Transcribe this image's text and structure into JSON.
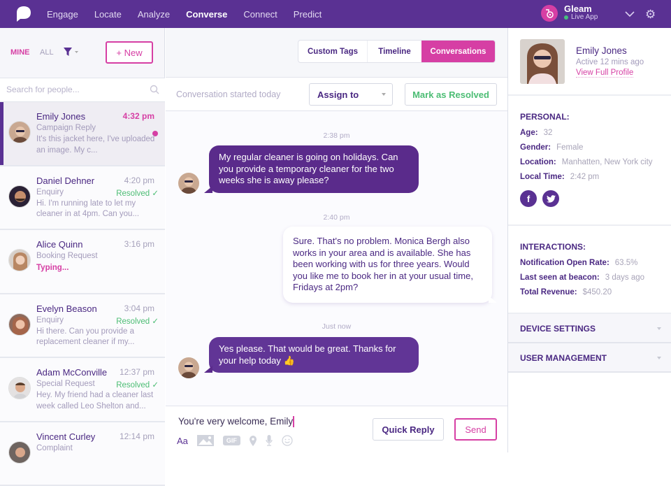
{
  "topbar": {
    "nav": [
      {
        "label": "Engage",
        "active": false
      },
      {
        "label": "Locate",
        "active": false
      },
      {
        "label": "Analyze",
        "active": false
      },
      {
        "label": "Converse",
        "active": true
      },
      {
        "label": "Connect",
        "active": false
      },
      {
        "label": "Predict",
        "active": false
      }
    ],
    "app": {
      "name": "Gleam",
      "status": "Live App",
      "icon": "vacuum-cleaner-icon"
    }
  },
  "left": {
    "filter_mine": "MINE",
    "filter_all": "ALL",
    "new_button": "+ New",
    "search_placeholder": "Search for people...",
    "conversations": [
      {
        "name": "Emily Jones",
        "time": "4:32 pm",
        "subject": "Campaign Reply",
        "status": "",
        "preview": "It's this jacket here, I've uploaded an image. My c...",
        "unread": true,
        "active": true
      },
      {
        "name": "Daniel Dehner",
        "time": "4:20 pm",
        "subject": "Enquiry",
        "status": "Resolved ✓",
        "preview": "Hi. I'm running late to let my cleaner in at 4pm. Can you..."
      },
      {
        "name": "Alice Quinn",
        "time": "3:16 pm",
        "subject": "Booking Request",
        "status": "",
        "typing": "Typing..."
      },
      {
        "name": "Evelyn Beason",
        "time": "3:04 pm",
        "subject": "Enquiry",
        "status": "Resolved ✓",
        "preview": "Hi there. Can you provide a replacement cleaner if my..."
      },
      {
        "name": "Adam McConville",
        "time": "12:37 pm",
        "subject": "Special Request",
        "status": "Resolved ✓",
        "preview": "Hey. My friend had a cleaner last week called Leo Shelton and..."
      },
      {
        "name": "Vincent Curley",
        "time": "12:14 pm",
        "subject": "Complaint",
        "status": "",
        "preview": ""
      }
    ]
  },
  "center": {
    "tabs": [
      "Custom Tags",
      "Timeline",
      "Conversations"
    ],
    "active_tab": "Conversations",
    "conversation_started": "Conversation started today",
    "assign_to": "Assign to",
    "mark_resolved": "Mark as Resolved",
    "messages": [
      {
        "time": "2:38 pm",
        "direction": "in",
        "text": "My regular cleaner is going on holidays. Can you provide a temporary cleaner for the two weeks she is away please?"
      },
      {
        "time": "2:40 pm",
        "direction": "out",
        "text": "Sure. That's no problem. Monica Bergh also works in your area and is available. She has been working with us for three years. Would you like me to book her in at your usual time, Fridays at 2pm?"
      },
      {
        "time": "Just now",
        "direction": "in",
        "text": "Yes please. That would be great. Thanks for your help today 👍"
      }
    ],
    "composer": {
      "value": "You're very welcome, Emily",
      "font_label": "Aa",
      "gif_label": "GIF",
      "quick_reply": "Quick Reply",
      "send": "Send"
    }
  },
  "right": {
    "name": "Emily Jones",
    "active": "Active 12 mins ago",
    "view_profile": "View Full Profile",
    "personal_title": "PERSONAL:",
    "personal": [
      {
        "key": "Age:",
        "value": "32"
      },
      {
        "key": "Gender:",
        "value": "Female"
      },
      {
        "key": "Location:",
        "value": "Manhatten, New York city"
      },
      {
        "key": "Local Time:",
        "value": "2:42 pm"
      }
    ],
    "social": [
      "f",
      "t"
    ],
    "interactions_title": "INTERACTIONS:",
    "interactions": [
      {
        "key": "Notification Open Rate:",
        "value": "63.5%"
      },
      {
        "key": "Last seen at beacon:",
        "value": "3 days ago"
      },
      {
        "key": "Total Revenue:",
        "value": "$450.20"
      }
    ],
    "device_settings": "DEVICE SETTINGS",
    "user_management": "USER MANAGEMENT"
  },
  "colors": {
    "brand": "#5a3193",
    "accent": "#d63fa4",
    "success": "#4cbd74"
  }
}
